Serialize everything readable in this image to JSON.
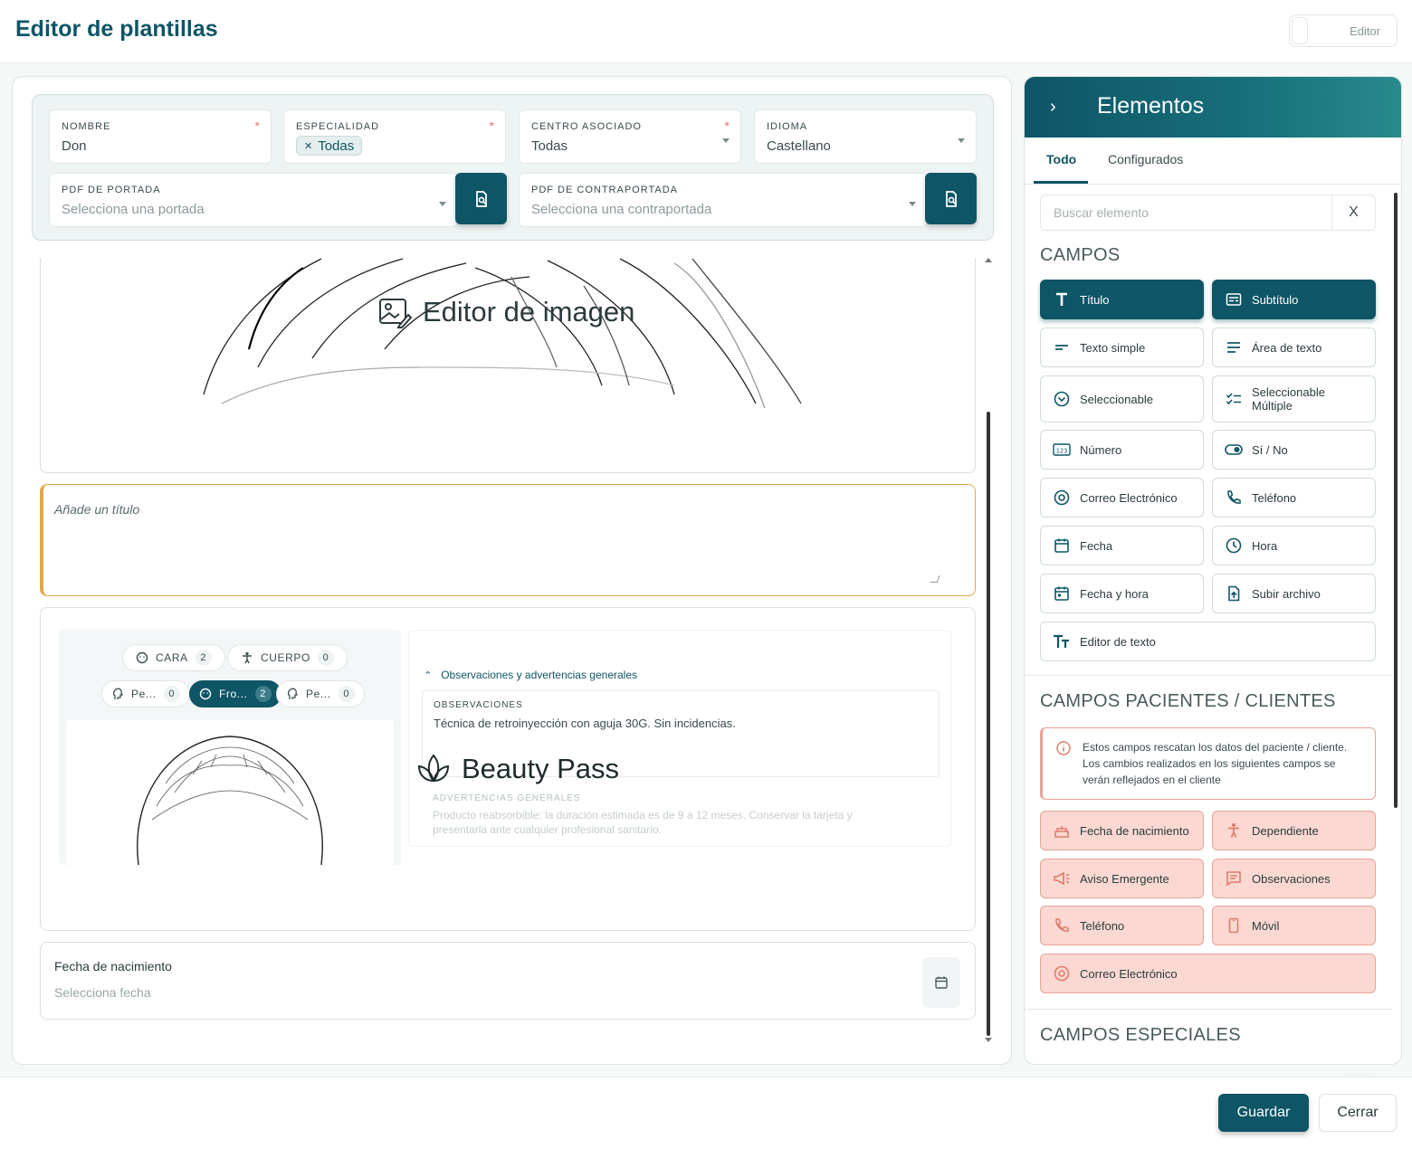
{
  "header": {
    "title": "Editor de plantillas",
    "mode_label": "Editor"
  },
  "config": {
    "nombre": {
      "label": "NOMBRE",
      "value": "Don",
      "required": "*"
    },
    "especialidad": {
      "label": "ESPECIALIDAD",
      "chip": "Todas",
      "required": "*"
    },
    "centro": {
      "label": "CENTRO ASOCIADO",
      "value": "Todas",
      "required": "*"
    },
    "idioma": {
      "label": "IDIOMA",
      "value": "Castellano"
    },
    "portada": {
      "label": "PDF DE PORTADA",
      "placeholder": "Selecciona una portada"
    },
    "contraportada": {
      "label": "PDF DE CONTRAPORTADA",
      "placeholder": "Selecciona una contraportada"
    }
  },
  "canvas": {
    "image_editor_title": "Editor de imagen",
    "title_placeholder": "Añade un título",
    "body_tabs": [
      {
        "label": "CARA",
        "count": "2"
      },
      {
        "label": "CUERPO",
        "count": "0"
      }
    ],
    "face_views": [
      {
        "label": "Pe...",
        "count": "0"
      },
      {
        "label": "Fro...",
        "count": "2"
      },
      {
        "label": "Pe...",
        "count": "0"
      }
    ],
    "observations": {
      "section": "Observaciones y advertencias generales",
      "obs_label": "OBSERVACIONES",
      "obs_text": "Técnica de retroinyección con aguja 30G. Sin incidencias.",
      "brand": "Beauty Pass",
      "warn_label": "ADVERTENCIAS GENERALES",
      "warn_text": "Producto reabsorbible: la duración estimada es de 9 a 12 meses. Conservar la tarjeta y presentarla ante cualquier profesional sanitario."
    },
    "birthdate": {
      "label": "Fecha de nacimiento",
      "placeholder": "Selecciona fecha"
    }
  },
  "sidebar": {
    "title": "Elementos",
    "tabs": [
      "Todo",
      "Configurados"
    ],
    "search_placeholder": "Buscar elemento",
    "clear_label": "X",
    "campos_title": "CAMPOS",
    "campos": [
      {
        "label": "Título",
        "icon": "title-icon"
      },
      {
        "label": "Subtítulo",
        "icon": "subtitle-icon"
      },
      {
        "label": "Texto simple",
        "icon": "short-text-icon"
      },
      {
        "label": "Área de texto",
        "icon": "text-area-icon"
      },
      {
        "label": "Seleccionable",
        "icon": "select-icon"
      },
      {
        "label": "Seleccionable Múltiple",
        "icon": "multi-select-icon"
      },
      {
        "label": "Número",
        "icon": "number-icon"
      },
      {
        "label": "Sí / No",
        "icon": "toggle-icon"
      },
      {
        "label": "Correo Electrónico",
        "icon": "at-icon"
      },
      {
        "label": "Teléfono",
        "icon": "phone-icon"
      },
      {
        "label": "Fecha",
        "icon": "calendar-icon"
      },
      {
        "label": "Hora",
        "icon": "clock-icon"
      },
      {
        "label": "Fecha y hora",
        "icon": "calendar-clock-icon"
      },
      {
        "label": "Subir archivo",
        "icon": "upload-file-icon"
      },
      {
        "label": "Editor de texto",
        "icon": "rich-text-icon"
      }
    ],
    "pacientes_title": "CAMPOS PACIENTES / CLIENTES",
    "pacientes_note": "Estos campos rescatan los datos del paciente / cliente. Los cambios realizados en los siguientes campos se verán reflejados en el cliente",
    "pacientes": [
      {
        "label": "Fecha de nacimiento",
        "icon": "cake-icon"
      },
      {
        "label": "Dependiente",
        "icon": "person-icon"
      },
      {
        "label": "Aviso Emergente",
        "icon": "megaphone-icon"
      },
      {
        "label": "Observaciones",
        "icon": "notes-icon"
      },
      {
        "label": "Teléfono",
        "icon": "phone-icon"
      },
      {
        "label": "Móvil",
        "icon": "mobile-icon"
      },
      {
        "label": "Correo Electrónico",
        "icon": "at-icon"
      }
    ],
    "especiales_title": "CAMPOS ESPECIALES"
  },
  "footer": {
    "save": "Guardar",
    "close": "Cerrar"
  },
  "colors": {
    "primary": "#0e5566",
    "accent_orange": "#e0a84a",
    "patient_pink": "#fbd9d2"
  }
}
